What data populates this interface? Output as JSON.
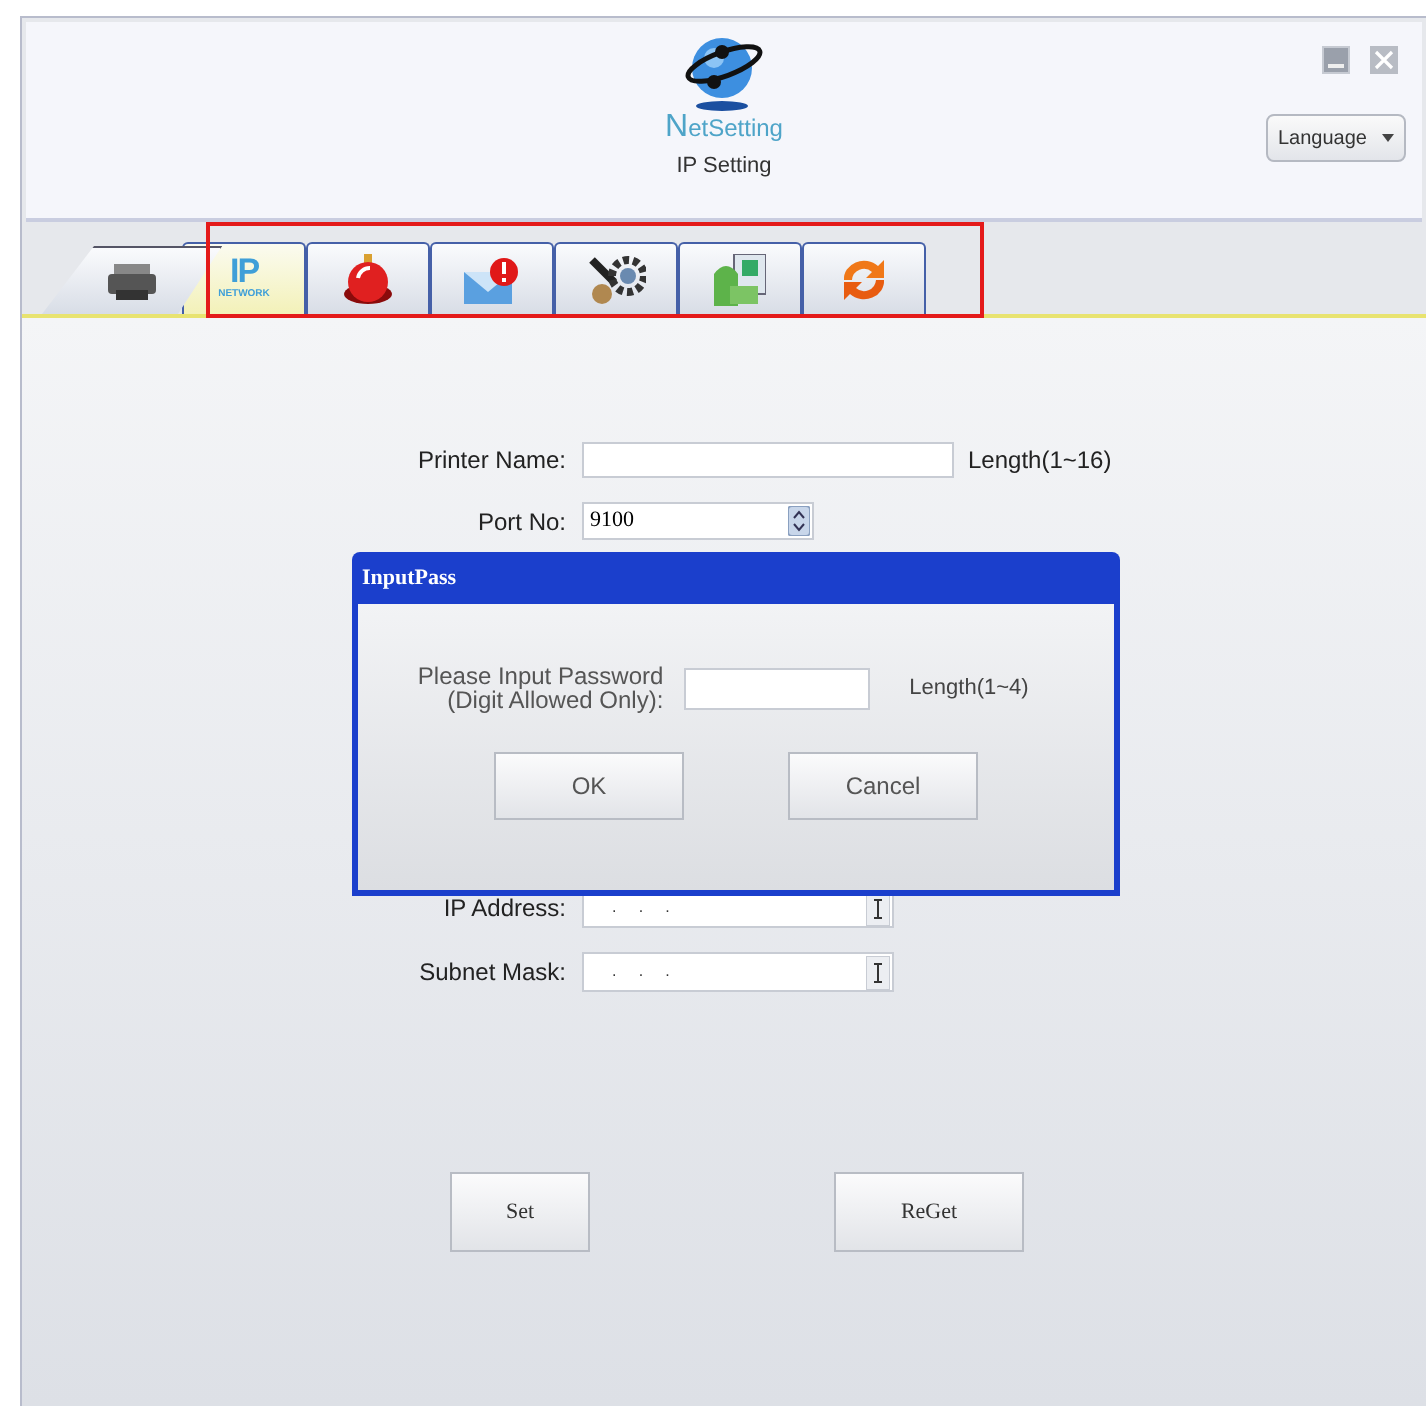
{
  "header": {
    "logo_text": "NetSetting",
    "subtitle": "IP Setting",
    "language": "Language"
  },
  "tabs": [
    {
      "kind": "printer",
      "selected": false
    },
    {
      "kind": "ip",
      "selected": true,
      "label": "IP",
      "caption": "NETWORK"
    },
    {
      "kind": "alarm",
      "selected": false
    },
    {
      "kind": "mail",
      "selected": false
    },
    {
      "kind": "tools",
      "selected": false
    },
    {
      "kind": "xy",
      "selected": false
    },
    {
      "kind": "refresh",
      "selected": false
    }
  ],
  "form": [
    {
      "kind": "text",
      "label": "Printer Name:",
      "hint": "Length(1~16)"
    },
    {
      "kind": "spin",
      "label": "Port No:",
      "value": "9100"
    },
    {
      "kind": "ip",
      "label": "IP Address:",
      "value": ".     .     ."
    },
    {
      "kind": "ip",
      "label": "Subnet Mask:",
      "value": ".     .     ."
    }
  ],
  "buttons": [
    "Set",
    "ReGet"
  ],
  "dialog": {
    "title": "InputPass",
    "prompt": "Please Input Password\n(Digit Allowed Only):",
    "hint": "Length(1~4)",
    "buttons": [
      "OK",
      "Cancel"
    ]
  }
}
